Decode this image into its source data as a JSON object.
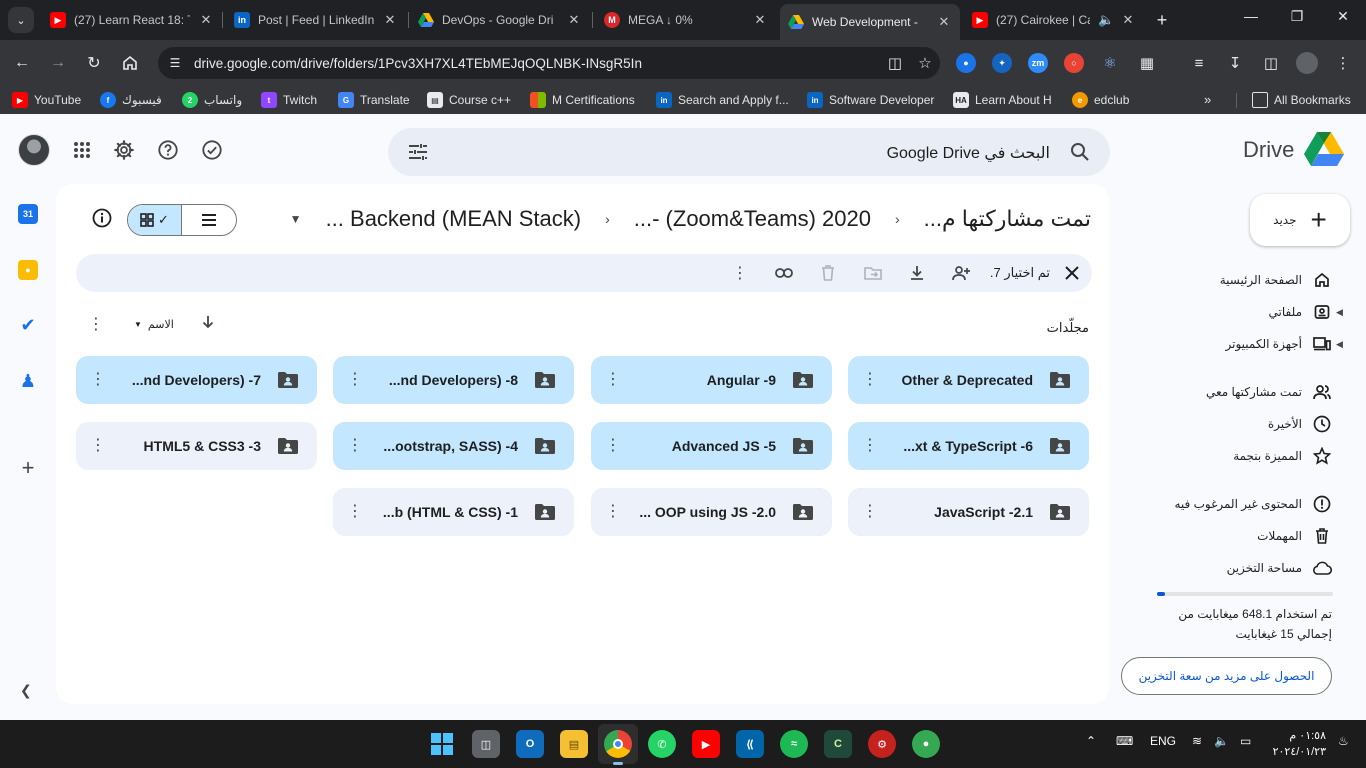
{
  "browser": {
    "tabs": [
      {
        "title": "(27) Learn React 18: T",
        "icon": "youtube-icon",
        "active": false
      },
      {
        "title": "Post | Feed | LinkedIn",
        "icon": "linkedin-icon",
        "active": false
      },
      {
        "title": "DevOps - Google Dri",
        "icon": "google-drive-icon",
        "active": false
      },
      {
        "title": "MEGA ↓ 0%",
        "icon": "mega-icon",
        "active": false
      },
      {
        "title": "Web Development - ",
        "icon": "google-drive-icon",
        "active": true
      },
      {
        "title": "(27) Cairokee | Ca",
        "icon": "youtube-icon",
        "active": false
      }
    ],
    "url": "drive.google.com/drive/folders/1Pcv3XH7XL4TEbMEJqOQLNBK-INsgR5In"
  },
  "bookmarks": [
    {
      "label": "YouTube",
      "icon": "youtube-icon"
    },
    {
      "label": "فيسبوك",
      "icon": "facebook-icon"
    },
    {
      "label": "واتساب",
      "icon": "whatsapp-icon"
    },
    {
      "label": "Twitch",
      "icon": "twitch-icon"
    },
    {
      "label": "Translate",
      "icon": "translate-icon"
    },
    {
      "label": "Course c++",
      "icon": "page-icon"
    },
    {
      "label": "M Certifications",
      "icon": "microsoft-icon"
    },
    {
      "label": "Search and Apply f...",
      "icon": "linkedin-icon"
    },
    {
      "label": "Software Developer",
      "icon": "linkedin-icon"
    },
    {
      "label": "Learn About H",
      "icon": "ha-icon"
    },
    {
      "label": "edclub",
      "icon": "edclub-icon"
    }
  ],
  "bookmarks_all": "All Bookmarks",
  "drive": {
    "product_name": "Drive",
    "search_text": "البحث في Google Drive",
    "breadcrumbs": [
      "تمت مشاركتها م...",
      "2020 (Zoom&Teams) -...",
      "Backend (MEAN Stack) ..."
    ],
    "selection_text": "تم اختيار 7.",
    "section_label": "مجلّدات",
    "sort_label": "الاسم",
    "folders": [
      {
        "name": "Other & Deprecated",
        "selected": true
      },
      {
        "name": "Angular -9",
        "selected": true
      },
      {
        "name": "...nd Developers) -8",
        "selected": true
      },
      {
        "name": "...nd Developers) -7",
        "selected": true
      },
      {
        "name": "...xt & TypeScript -6",
        "selected": true
      },
      {
        "name": "Advanced JS -5",
        "selected": true
      },
      {
        "name": "...ootstrap, SASS) -4",
        "selected": true
      },
      {
        "name": "HTML5 & CSS3 -3",
        "selected": false
      },
      {
        "name": "JavaScript -2.1",
        "selected": false
      },
      {
        "name": "... OOP using JS -2.0",
        "selected": false
      },
      {
        "name": "...b (HTML & CSS) -1",
        "selected": false
      }
    ],
    "new_label": "جديد",
    "nav": [
      {
        "label": "الصفحة الرئيسية",
        "icon": "home-icon"
      },
      {
        "label": "ملفاتي",
        "icon": "my-drive-icon"
      },
      {
        "label": "أجهزة الكمبيوتر",
        "icon": "computers-icon"
      },
      {
        "label": "تمت مشاركتها معي",
        "icon": "shared-icon"
      },
      {
        "label": "الأخيرة",
        "icon": "clock-icon"
      },
      {
        "label": "المميزة بنجمة",
        "icon": "star-icon"
      },
      {
        "label": "المحتوى غير المرغوب فيه",
        "icon": "spam-icon"
      },
      {
        "label": "المهملات",
        "icon": "trash-icon"
      },
      {
        "label": "مساحة التخزين",
        "icon": "cloud-icon"
      }
    ],
    "storage_used_fraction": 0.043,
    "storage_text": "تم استخدام 648.1 ميغابايت من إجمالي 15 غيغابايت",
    "get_storage_label": "الحصول على مزيد من سعة التخزين"
  },
  "taskbar": {
    "language": "ENG",
    "time": "٠١:٥٨ م",
    "date": "٢٠٢٤/٠١/٢٣"
  },
  "colors": {
    "selected_folder": "#c2e7ff",
    "unselected_folder": "#edf2fa",
    "accent": "#0b57d0"
  }
}
